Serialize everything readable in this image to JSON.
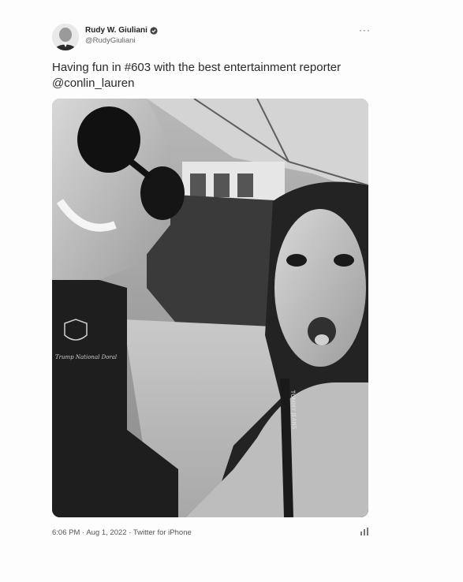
{
  "author": {
    "name": "Rudy W. Giuliani",
    "handle": "@RudyGiuliani"
  },
  "more_icon": "more-horizontal-icon",
  "tweet": {
    "text_before": "Having fun in ",
    "hashtag": "#603",
    "text_middle": " with the best entertainment reporter ",
    "mention": "@conlin_lauren"
  },
  "photo_text": {
    "shirt_emblem": "Trump National Doral",
    "strap": "TOMMY JEANS"
  },
  "meta": {
    "time": "6:06 PM",
    "separator1": " · ",
    "date": "Aug 1, 2022",
    "separator2": " · ",
    "source": "Twitter for iPhone"
  },
  "colors": {
    "background": "#fdfdfd",
    "text": "#2a2a2a",
    "muted": "#666666"
  }
}
